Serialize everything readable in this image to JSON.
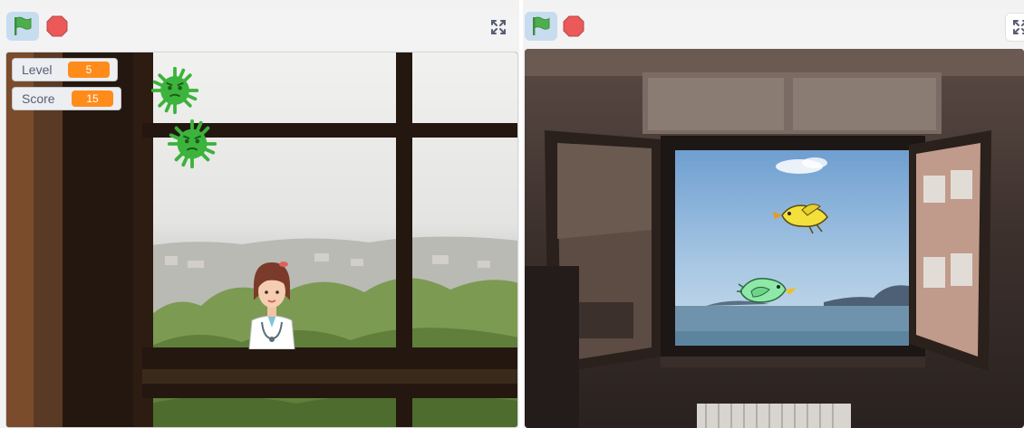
{
  "players": [
    {
      "id": "left",
      "controls": {
        "green_flag": "green-flag-icon",
        "stop": "stop-icon",
        "fullscreen": "fullscreen-icon"
      },
      "monitors": [
        {
          "label": "Level",
          "value": "5"
        },
        {
          "label": "Score",
          "value": "15"
        }
      ],
      "sprites": [
        "virus-sprite",
        "virus-sprite",
        "doctor-sprite"
      ],
      "backdrop": "window-city-view"
    },
    {
      "id": "right",
      "controls": {
        "green_flag": "green-flag-icon",
        "stop": "stop-icon",
        "fullscreen": "fullscreen-icon"
      },
      "sprites": [
        "yellow-bird-sprite",
        "green-bird-sprite"
      ],
      "backdrop": "open-window-sea-view"
    }
  ],
  "colors": {
    "flag_green": "#4cae4c",
    "flag_button_bg": "#c7dcef",
    "stop_red": "#ec5959",
    "monitor_orange": "#ff8c1a",
    "virus_green": "#3cb43c"
  }
}
